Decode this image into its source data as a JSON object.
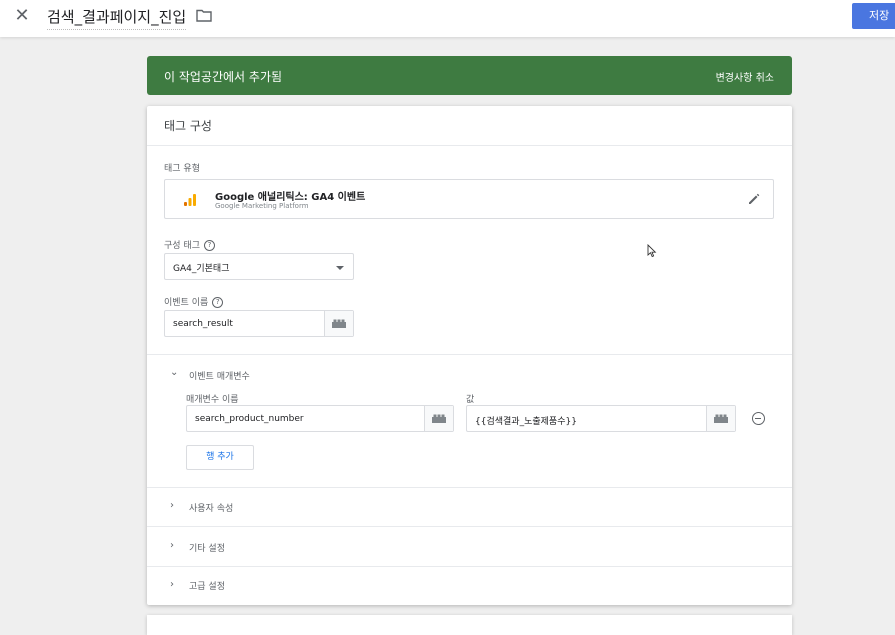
{
  "header": {
    "close_icon": "close-icon",
    "title": "검색_결과페이지_진입",
    "folder_icon": "folder-icon",
    "save_label": "저장",
    "save_color": "#4a76e0"
  },
  "banner": {
    "text": "이 작업공간에서 추가됨",
    "undo_label": "변경사항 취소",
    "color": "#3e7b41"
  },
  "card": {
    "title": "태그 구성",
    "tag_type": {
      "label": "태그 유형",
      "name": "Google 애널리틱스: GA4 이벤트",
      "subtitle": "Google Marketing Platform",
      "icon": "google-analytics-icon",
      "edit_icon": "pencil-icon"
    },
    "config_tag": {
      "label": "구성 태그",
      "value": "GA4_기본태그"
    },
    "event_name": {
      "label": "이벤트 이름",
      "value": "search_result"
    },
    "event_params": {
      "section_label": "이벤트 매개변수",
      "name_header": "매개변수 이름",
      "value_header": "값",
      "rows": [
        {
          "name": "search_product_number",
          "value": "{{검색결과_노출제품수}}"
        }
      ],
      "add_row_label": "행 추가"
    },
    "collapsed_sections": [
      {
        "label": "사용자 속성"
      },
      {
        "label": "기타 설정"
      },
      {
        "label": "고급 설정"
      }
    ]
  }
}
